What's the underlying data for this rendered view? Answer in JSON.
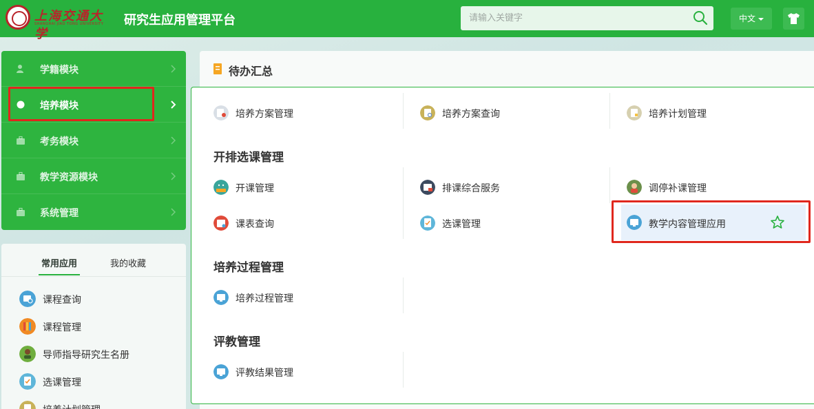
{
  "header": {
    "logo_name": "上海交通大学",
    "logo_sub": "SHANGHAI JIAO TONG UNIVERSITY",
    "title": "研究生应用管理平台",
    "search_placeholder": "请输入关键字",
    "lang_label": "中文"
  },
  "modules": [
    {
      "label": "学籍模块",
      "icon": "user-icon",
      "state": "dim"
    },
    {
      "label": "培养模块",
      "icon": "dot-icon",
      "state": "active"
    },
    {
      "label": "考务模块",
      "icon": "briefcase-icon",
      "state": "dim"
    },
    {
      "label": "教学资源模块",
      "icon": "briefcase-icon",
      "state": "dim"
    },
    {
      "label": "系统管理",
      "icon": "briefcase-icon",
      "state": "dim"
    }
  ],
  "apps": {
    "tabs": [
      "常用应用",
      "我的收藏"
    ],
    "items": [
      {
        "label": "课程查询",
        "color": "#4aa3d6"
      },
      {
        "label": "课程管理",
        "color": "#f08a24"
      },
      {
        "label": "导师指导研究生名册",
        "color": "#6fae3e"
      },
      {
        "label": "选课管理",
        "color": "#5fb6d9"
      },
      {
        "label": "培养计划管理",
        "color": "#c8b25a"
      }
    ]
  },
  "todo": {
    "title": "待办汇总"
  },
  "dropdown": {
    "top_items": [
      "培养方案管理",
      "培养方案查询",
      "培养计划管理"
    ],
    "groups": [
      {
        "title": "开排选课管理",
        "items": [
          "开课管理",
          "排课综合服务",
          "调停补课管理",
          "课表查询",
          "选课管理",
          "教学内容管理应用"
        ]
      },
      {
        "title": "培养过程管理",
        "items": [
          "培养过程管理"
        ]
      },
      {
        "title": "评教管理",
        "items": [
          "评教结果管理"
        ]
      }
    ]
  },
  "colors": {
    "brand_green": "#28b13e",
    "highlight_red": "#e0271d"
  }
}
